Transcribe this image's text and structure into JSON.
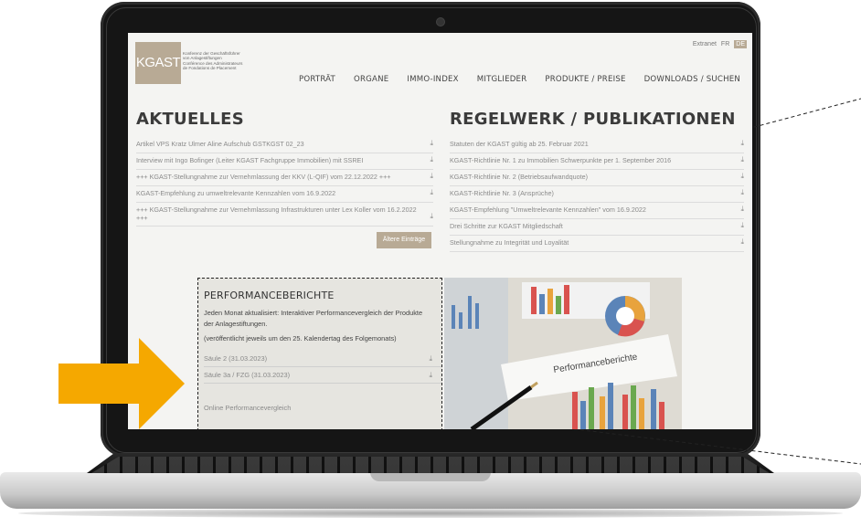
{
  "header": {
    "logo_text": "KGAST",
    "logo_subtext": "Konferenz der Geschäftsführer\nvon Anlagestiftungen\nConférence des Administrateurs\nde Fondations de Placement",
    "top_links": [
      "Extranet",
      "FR",
      "DE"
    ],
    "nav": [
      "PORTRÄT",
      "ORGANE",
      "IMMO-INDEX",
      "MITGLIEDER",
      "PRODUKTE / PREISE",
      "DOWNLOADS / SUCHEN"
    ]
  },
  "aktuelles": {
    "title": "AKTUELLES",
    "items": [
      "Artikel VPS Kratz Ulmer Aline Aufschub GSTKGST 02_23",
      "Interview mit Ingo Bofinger (Leiter KGAST Fachgruppe Immobilien) mit SSREI",
      "+++ KGAST-Stellungnahme zur Vernehmlassung der KKV (L-QIF) vom 22.12.2022 +++",
      "KGAST-Empfehlung zu umweltrelevante Kennzahlen vom 16.9.2022",
      "+++ KGAST-Stellungnahme zur Vernehmlassung Infrastrukturen unter Lex Koller vom 16.2.2022 +++"
    ],
    "older_button": "Ältere Einträge"
  },
  "regelwerk": {
    "title": "REGELWERK / PUBLIKATIONEN",
    "items": [
      "Statuten der KGAST gültig ab 25. Februar 2021",
      "KGAST-Richtlinie Nr. 1 zu Immobilien Schwerpunkte per 1. September 2016",
      "KGAST-Richtlinie Nr. 2 (Betriebsaufwandquote)",
      "KGAST-Richtlinie Nr. 3 (Ansprüche)",
      "KGAST-Empfehlung \"Umweltrelevante Kennzahlen\" vom 16.9.2022",
      "Drei Schritte zur KGAST Mitgliedschaft",
      "Stellungnahme zu Integrität und Loyalität"
    ]
  },
  "performance": {
    "title": "PERFORMANCEBERICHTE",
    "description": "Jeden Monat aktualisiert: Interaktiver Performancevergleich der Produkte der Anlagestiftungen.",
    "note": "(veröffentlicht jeweils um den 25. Kalendertag des Folgemonats)",
    "links": [
      "Säule 2 (31.03.2023)",
      "Säule 3a / FZG (31.03.2023)"
    ],
    "online_link": "Online Performancevergleich",
    "image_caption": "Performanceberichte"
  },
  "colors": {
    "accent": "#b8aa95",
    "arrow": "#f5a800",
    "lid": "#151515"
  },
  "icons": {
    "download": "download-icon",
    "arrow": "orange-arrow-icon",
    "camera": "camera-icon"
  }
}
